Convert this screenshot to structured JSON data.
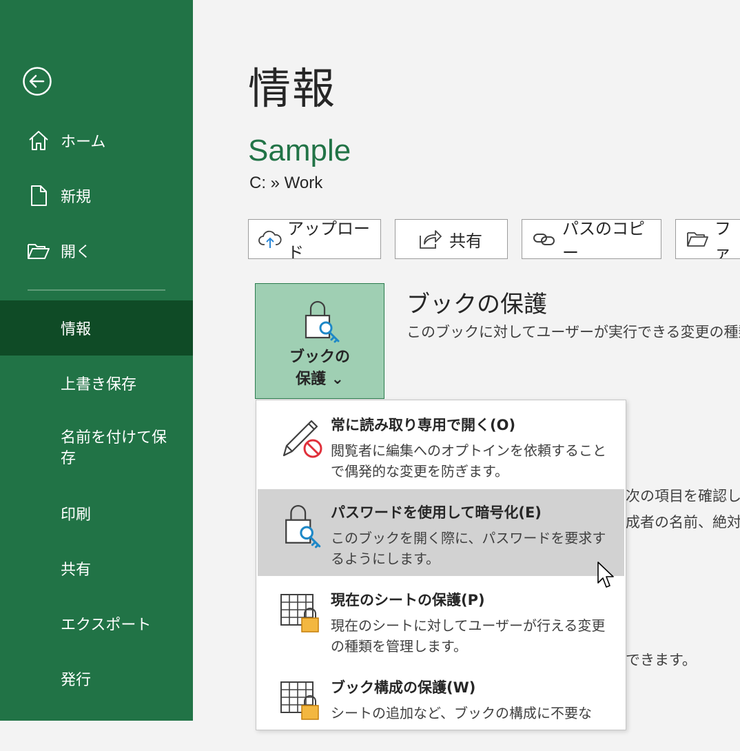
{
  "sidebar": {
    "items": [
      {
        "label": "ホーム",
        "icon": "home-icon"
      },
      {
        "label": "新規",
        "icon": "new-document-icon"
      },
      {
        "label": "開く",
        "icon": "open-folder-icon"
      },
      {
        "label": "情報",
        "active": true
      },
      {
        "label": "上書き保存"
      },
      {
        "label": "名前を付けて保存"
      },
      {
        "label": "印刷"
      },
      {
        "label": "共有"
      },
      {
        "label": "エクスポート"
      },
      {
        "label": "発行"
      }
    ]
  },
  "page": {
    "title": "情報",
    "doc_name": "Sample",
    "doc_path": "C: » Work"
  },
  "actions": [
    {
      "label": "アップロード",
      "icon": "cloud-upload-icon"
    },
    {
      "label": "共有",
      "icon": "share-icon"
    },
    {
      "label": "パスのコピー",
      "icon": "link-icon"
    },
    {
      "label": "ファ",
      "icon": "folder-icon"
    }
  ],
  "protect": {
    "button_label_line1": "ブックの",
    "button_label_line2": "保護 ⌄",
    "section_title": "ブックの保護",
    "section_desc": "このブックに対してユーザーが実行できる変更の種類"
  },
  "background_text": {
    "line1": "次の項目を確認し",
    "line2": "成者の名前、絶対",
    "line3": "できます。"
  },
  "menu": {
    "items": [
      {
        "title": "常に読み取り専用で開く(O)",
        "desc": "閲覧者に編集へのオプトインを依頼することで偶発的な変更を防ぎます。",
        "icon": "pencil-no-icon"
      },
      {
        "title": "パスワードを使用して暗号化(E)",
        "desc": "このブックを開く際に、パスワードを要求するようにします。",
        "icon": "lock-key-icon",
        "hover": true
      },
      {
        "title": "現在のシートの保護(P)",
        "desc": "現在のシートに対してユーザーが行える変更の種類を管理します。",
        "icon": "sheet-lock-icon"
      },
      {
        "title": "ブック構成の保護(W)",
        "desc": "シートの追加など、ブックの構成に不要な",
        "icon": "workbook-lock-icon"
      }
    ]
  },
  "colors": {
    "sidebar_bg": "#217346",
    "sidebar_active": "#0f4b26",
    "accent_green": "#217346",
    "protect_bg": "#9fcfb3",
    "lock_orange": "#f3b740"
  }
}
